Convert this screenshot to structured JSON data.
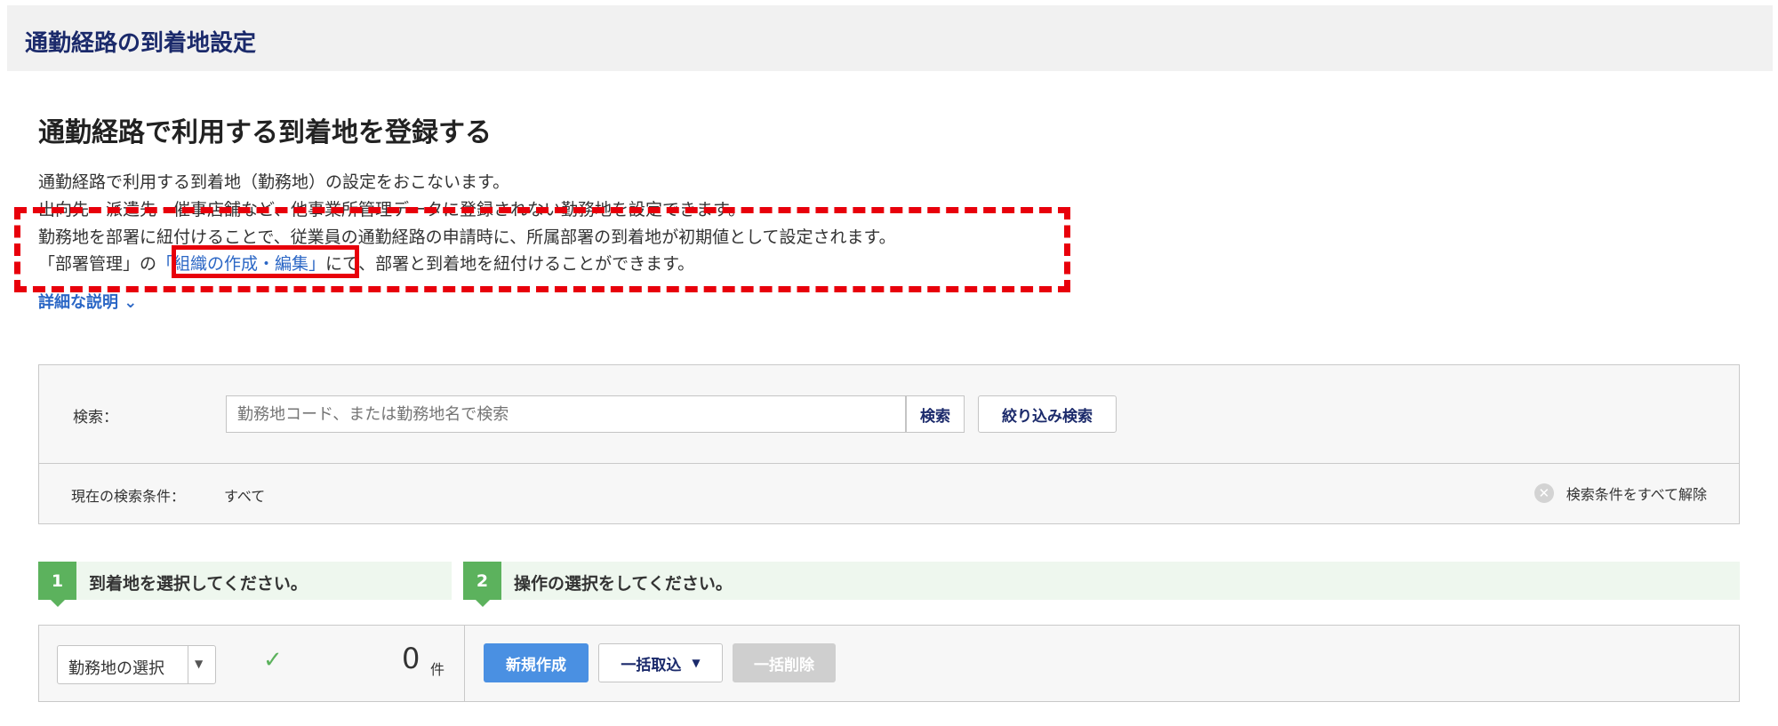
{
  "header": {
    "title": "通勤経路の到着地設定"
  },
  "section": {
    "title": "通勤経路で利用する到着地を登録する"
  },
  "description": {
    "line1": "通勤経路で利用する到着地（勤務地）の設定をおこないます。",
    "line2": "出向先・派遣先・催事店舗など、他事業所管理データに登録されない勤務地を設定できます。",
    "line3": "勤務地を部署に紐付けることで、従業員の通勤経路の申請時に、所属部署の到着地が初期値として設定されます。",
    "line4_prefix": "「部署管理」の",
    "line4_link": "「組織の作成・編集」",
    "line4_suffix": "にて、部署と到着地を紐付けることができます。",
    "detail_link": "詳細な説明 ⌄"
  },
  "search": {
    "label": "検索：",
    "placeholder": "勤務地コード、または勤務地名で検索",
    "search_button": "検索",
    "filter_button": "絞り込み検索",
    "condition_label": "現在の検索条件：",
    "condition_value": "すべて",
    "clear_label": "検索条件をすべて解除",
    "clear_icon": "close-circle-icon"
  },
  "steps": [
    {
      "number": "1",
      "label": "到着地を選択してください。"
    },
    {
      "number": "2",
      "label": "操作の選択をしてください。"
    }
  ],
  "actions": {
    "select_label": "勤務地の選択",
    "count": "0",
    "count_unit": "件",
    "new_button": "新規作成",
    "import_button": "一括取込",
    "delete_button": "一括削除"
  },
  "colors": {
    "header_title": "#1b2a6b",
    "link": "#2a66c5",
    "highlight_red": "#e8000b",
    "step_green": "#5cb25d",
    "primary_blue": "#4a90e2",
    "disabled_gray": "#cfcfcf"
  }
}
